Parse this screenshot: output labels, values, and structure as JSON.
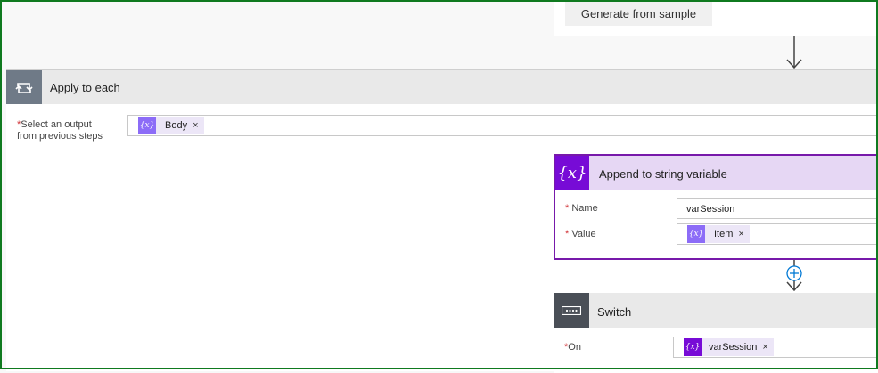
{
  "parse_json": {
    "generate_button": "Generate from sample"
  },
  "apply_to_each": {
    "title": "Apply to each",
    "select_label_line1": "Select an output",
    "select_label_line2": "from previous steps",
    "token": {
      "label": "Body",
      "remove": "×",
      "icon": "variable-icon",
      "color": "#8c6cf7"
    }
  },
  "append_variable": {
    "title": "Append to string variable",
    "icon_glyph": "{x}",
    "name_label": "Name",
    "name_value": "varSession",
    "value_label": "Value",
    "value_token": {
      "label": "Item",
      "remove": "×",
      "color": "#8c6cf7"
    },
    "accent": "#770bd6"
  },
  "switch": {
    "title": "Switch",
    "on_label": "On",
    "on_token": {
      "label": "varSession",
      "remove": "×",
      "color": "#770bd6"
    }
  },
  "required_marker": "*",
  "token_glyph": "{x}"
}
